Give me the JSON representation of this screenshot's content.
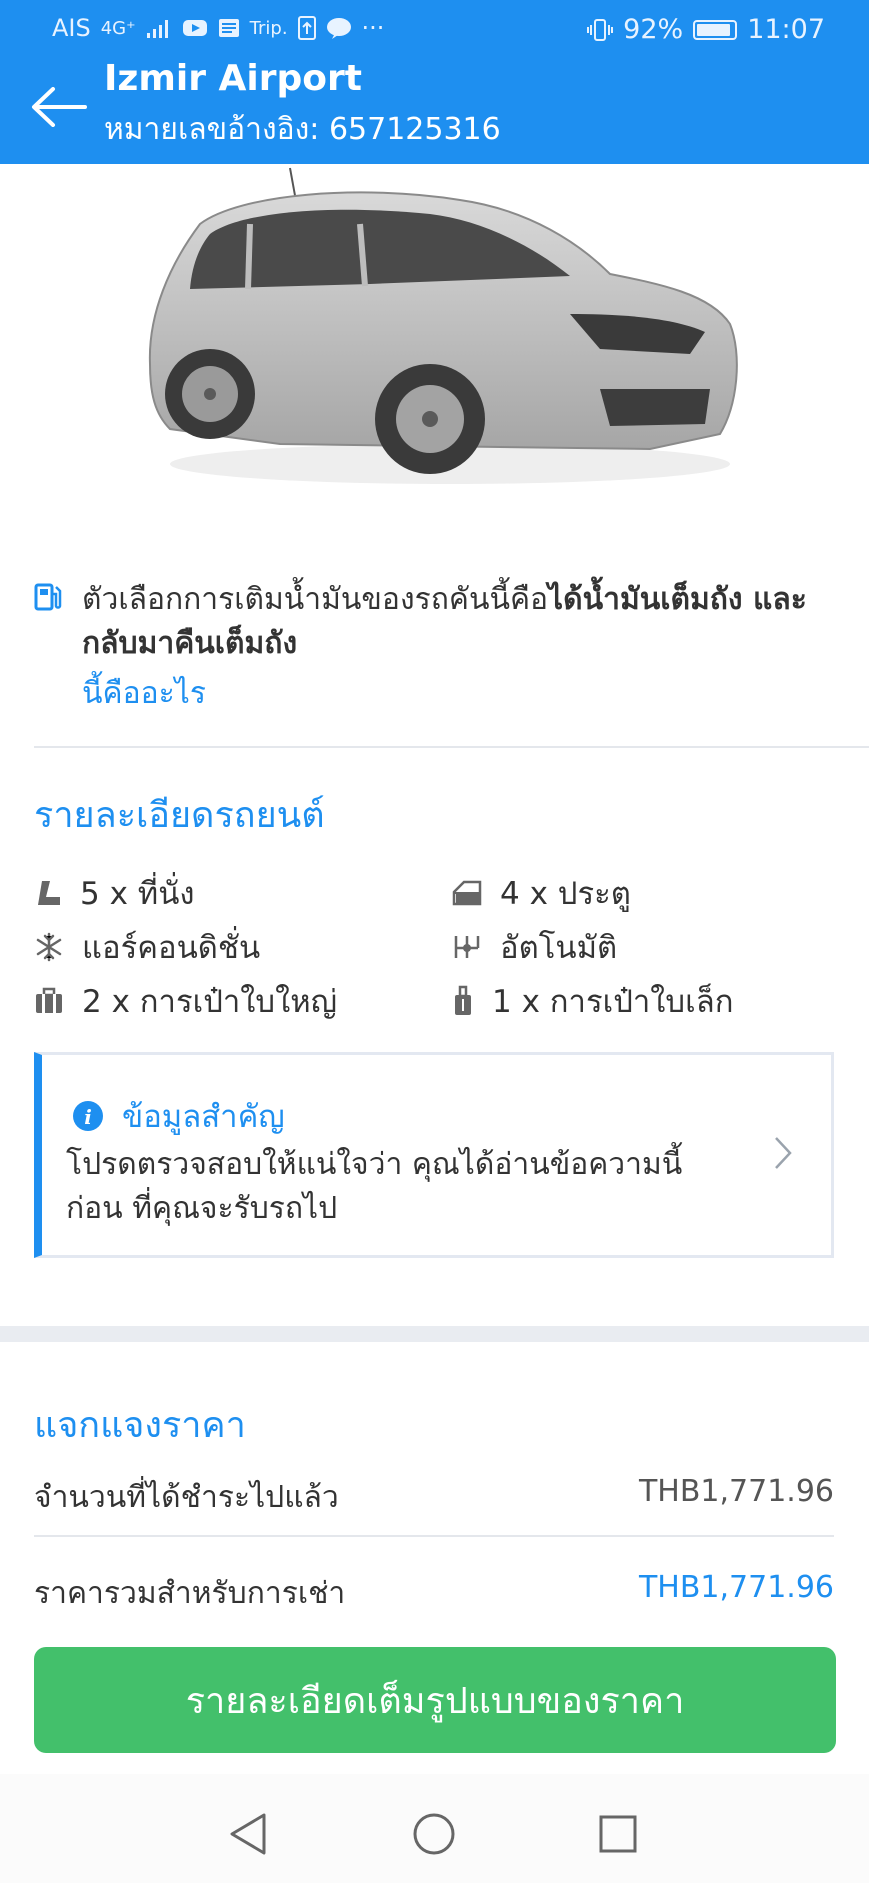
{
  "status_bar": {
    "carrier": "AIS",
    "network": "4G⁺",
    "app_trip": "Trip.",
    "app_line": "LINE",
    "more": "···",
    "battery": "92%",
    "battery_level": 0.92,
    "time": "11:07"
  },
  "header": {
    "title": "Izmir Airport",
    "subtitle": "หมายเลขอ้างอิง: 657125316"
  },
  "fuel": {
    "text_normal": "ตัวเลือกการเติมน้ำมันของรถคันนี้คือ",
    "text_bold": "ได้น้ำมันเต็มถัง และกลับมาคืนเต็มถัง",
    "link": "นี้คืออะไร"
  },
  "car_details": {
    "title": "รายละเอียดรถยนต์",
    "specs": [
      {
        "icon": "seat-icon",
        "text": "5 x  ที่นั่ง"
      },
      {
        "icon": "door-icon",
        "text": "4 x  ประตู"
      },
      {
        "icon": "snowflake-icon",
        "text": "แอร์คอนดิชั่น"
      },
      {
        "icon": "gearshift-icon",
        "text": "อัตโนมัติ"
      },
      {
        "icon": "large-suitcase-icon",
        "text": "2 x  การเป๋าใบใหญ่"
      },
      {
        "icon": "small-suitcase-icon",
        "text": "1 x  การเป๋าใบเล็ก"
      }
    ]
  },
  "notice": {
    "title": "ข้อมูลสำคัญ",
    "body": "โปรดตรวจสอบให้แน่ใจว่า คุณได้อ่านข้อความนี้ ก่อน ที่คุณจะรับรถไป"
  },
  "price": {
    "title": "แจกแจงราคา",
    "paid_label": "จำนวนที่ได้ชำระไปแล้ว",
    "paid_value": "THB1,771.96",
    "total_label": "ราคารวมสำหรับการเช่า",
    "total_value": "THB1,771.96",
    "button": "รายละเอียดเต็มรูปแบบของราคา"
  },
  "colors": {
    "brand_blue": "#1e8ff0",
    "cta_green": "#43c06b"
  }
}
